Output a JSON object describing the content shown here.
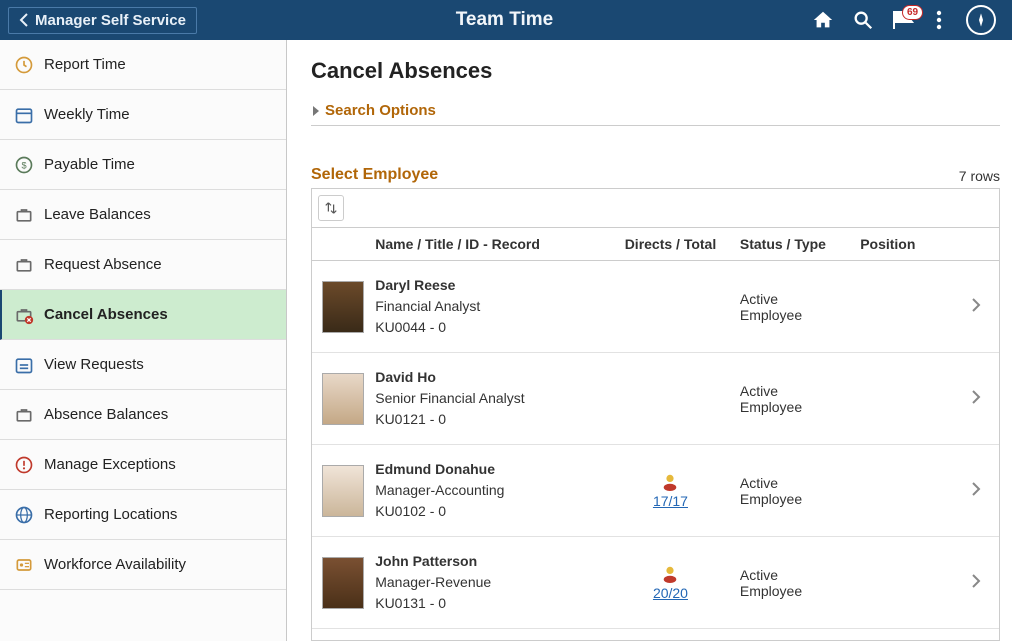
{
  "header": {
    "back_label": "Manager Self Service",
    "title": "Team Time",
    "notification_count": "69"
  },
  "sidebar": {
    "items": [
      {
        "label": "Report Time",
        "icon": "clock"
      },
      {
        "label": "Weekly Time",
        "icon": "calendar"
      },
      {
        "label": "Payable Time",
        "icon": "money-clock"
      },
      {
        "label": "Leave Balances",
        "icon": "suitcase"
      },
      {
        "label": "Request Absence",
        "icon": "suitcase"
      },
      {
        "label": "Cancel Absences",
        "icon": "suitcase-x",
        "active": true
      },
      {
        "label": "View Requests",
        "icon": "calendar-list"
      },
      {
        "label": "Absence Balances",
        "icon": "suitcase"
      },
      {
        "label": "Manage Exceptions",
        "icon": "alert"
      },
      {
        "label": "Reporting Locations",
        "icon": "globe"
      },
      {
        "label": "Workforce Availability",
        "icon": "badge"
      }
    ]
  },
  "main": {
    "page_title": "Cancel Absences",
    "search_options_label": "Search Options",
    "section_title": "Select Employee",
    "row_count_label": "7 rows",
    "columns": {
      "name": "Name / Title / ID - Record",
      "directs": "Directs / Total",
      "status": "Status / Type",
      "position": "Position"
    },
    "rows": [
      {
        "name": "Daryl Reese",
        "title": "Financial Analyst",
        "idrec": "KU0044 - 0",
        "directs": "",
        "status": "Active",
        "type": "Employee",
        "avatar": "av1"
      },
      {
        "name": "David Ho",
        "title": "Senior Financial Analyst",
        "idrec": "KU0121 - 0",
        "directs": "",
        "status": "Active",
        "type": "Employee",
        "avatar": "av2"
      },
      {
        "name": "Edmund Donahue",
        "title": "Manager-Accounting",
        "idrec": "KU0102 - 0",
        "directs": "17/17",
        "status": "Active",
        "type": "Employee",
        "avatar": "av3"
      },
      {
        "name": "John Patterson",
        "title": "Manager-Revenue",
        "idrec": "KU0131 - 0",
        "directs": "20/20",
        "status": "Active",
        "type": "Employee",
        "avatar": "av4"
      }
    ]
  }
}
